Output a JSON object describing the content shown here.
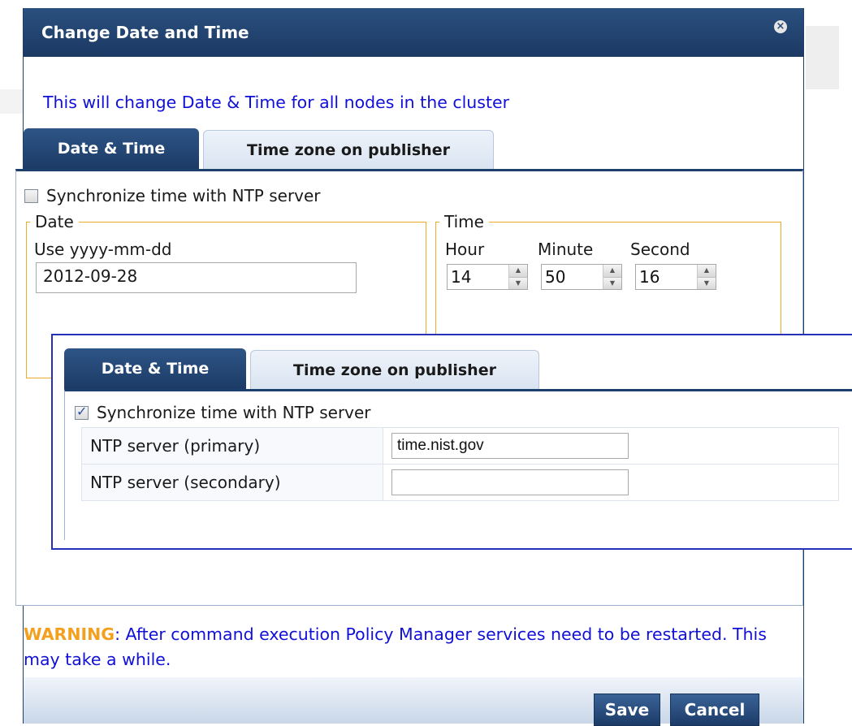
{
  "dialog": {
    "title": "Change Date and Time",
    "close_glyph": "×",
    "notice": "This will change Date & Time for all nodes in the cluster",
    "tabs": [
      "Date & Time",
      "Time zone on publisher"
    ],
    "sync_label": "Synchronize time with NTP server",
    "sync_checked": false,
    "date_group": {
      "legend": "Date",
      "hint": "Use yyyy-mm-dd",
      "value": "2012-09-28"
    },
    "time_group": {
      "legend": "Time",
      "hour_label": "Hour",
      "minute_label": "Minute",
      "second_label": "Second",
      "hour": "14",
      "minute": "50",
      "second": "16"
    },
    "warning_prefix": "WARNING",
    "warning_text": ": After command execution Policy Manager services need to be restarted. This may take a while.",
    "buttons": {
      "save": "Save",
      "cancel": "Cancel"
    }
  },
  "overlay": {
    "tabs": [
      "Date & Time",
      "Time zone on publisher"
    ],
    "sync_label": "Synchronize time with NTP server",
    "sync_checked": true,
    "ntp_primary_label": "NTP server (primary)",
    "ntp_primary_value": "time.nist.gov",
    "ntp_secondary_label": "NTP server (secondary)",
    "ntp_secondary_value": ""
  },
  "colors": {
    "title_bar": "#1d3f6e",
    "accent_text": "#1010d8",
    "warning": "#f3a01e",
    "fieldset_border": "#f1a92a"
  },
  "icons": {
    "close": "close-icon",
    "checkbox": "checkbox-icon",
    "spinner": "spinner-icon"
  }
}
